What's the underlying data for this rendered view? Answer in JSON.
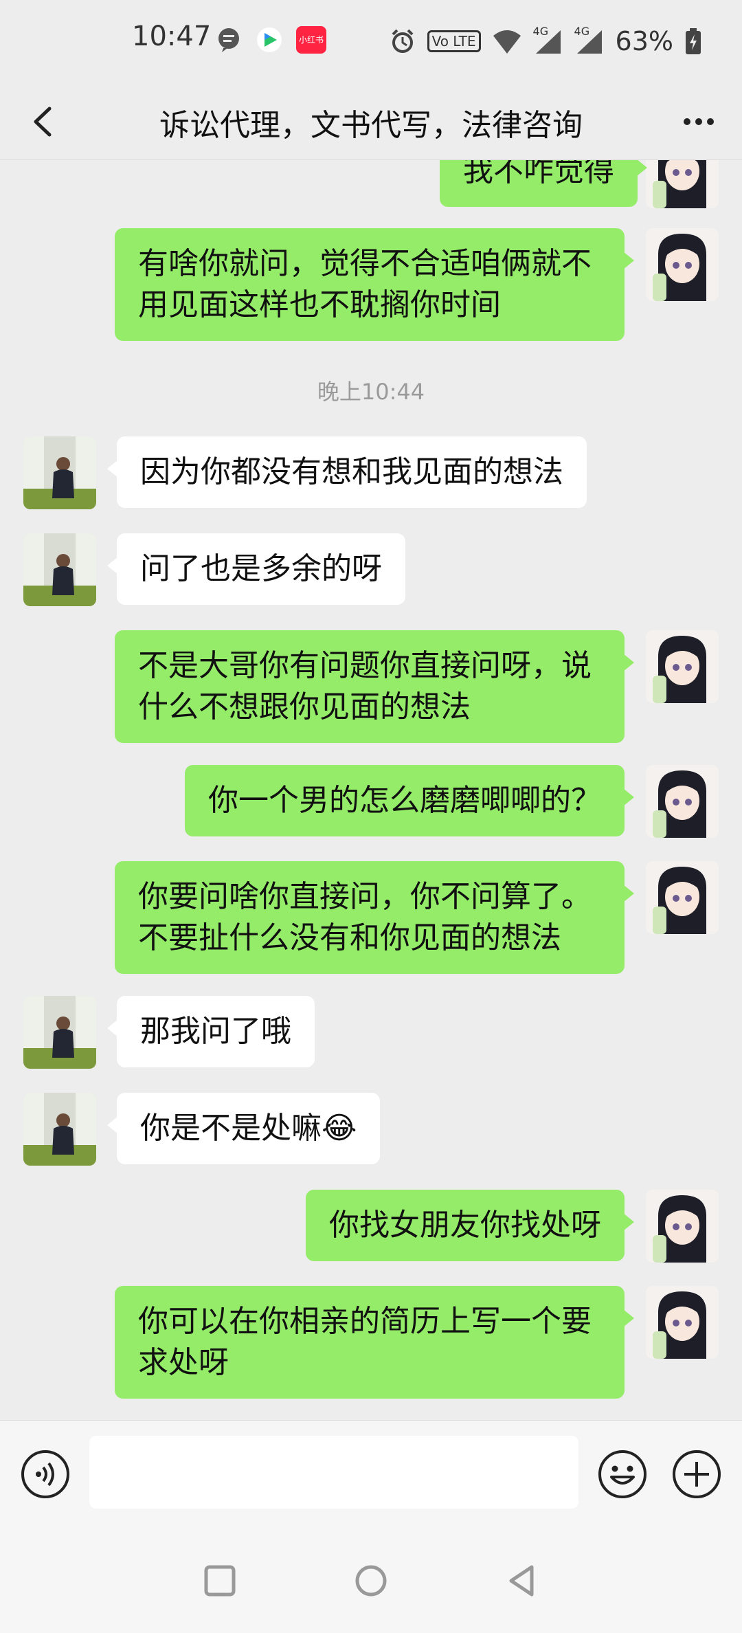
{
  "status_bar": {
    "time": "10:47",
    "app_badge": "小红书",
    "network_a": "4G",
    "network_b": "4G",
    "volte": "Vo LTE",
    "battery": "63%"
  },
  "title_bar": {
    "title": "诉讼代理，文书代写，法律咨询"
  },
  "messages": [
    {
      "side": "me",
      "text": "我不咋觉得"
    },
    {
      "side": "me",
      "text": "有啥你就问，觉得不合适咱俩就不用见面这样也不耽搁你时间"
    },
    {
      "side": "time",
      "text": "晚上10:44"
    },
    {
      "side": "other",
      "text": "因为你都没有想和我见面的想法"
    },
    {
      "side": "other",
      "text": "问了也是多余的呀"
    },
    {
      "side": "me",
      "text": "不是大哥你有问题你直接问呀，说什么不想跟你见面的想法"
    },
    {
      "side": "me",
      "text": "你一个男的怎么磨磨唧唧的？"
    },
    {
      "side": "me",
      "text": "你要问啥你直接问，你不问算了。不要扯什么没有和你见面的想法"
    },
    {
      "side": "other",
      "text": "那我问了哦"
    },
    {
      "side": "other",
      "text": "你是不是处嘛",
      "emoji": "😂"
    },
    {
      "side": "me",
      "text": "你找女朋友你找处呀"
    },
    {
      "side": "me",
      "text": "你可以在你相亲的简历上写一个要求处呀"
    }
  ],
  "colors": {
    "my_bubble": "#95ec69",
    "other_bubble": "#ffffff",
    "background": "#ededed"
  },
  "icons": {
    "back": "chevron-left-icon",
    "more": "more-dots-icon",
    "voice": "voice-icon",
    "emoji": "emoji-icon",
    "add": "plus-icon"
  }
}
